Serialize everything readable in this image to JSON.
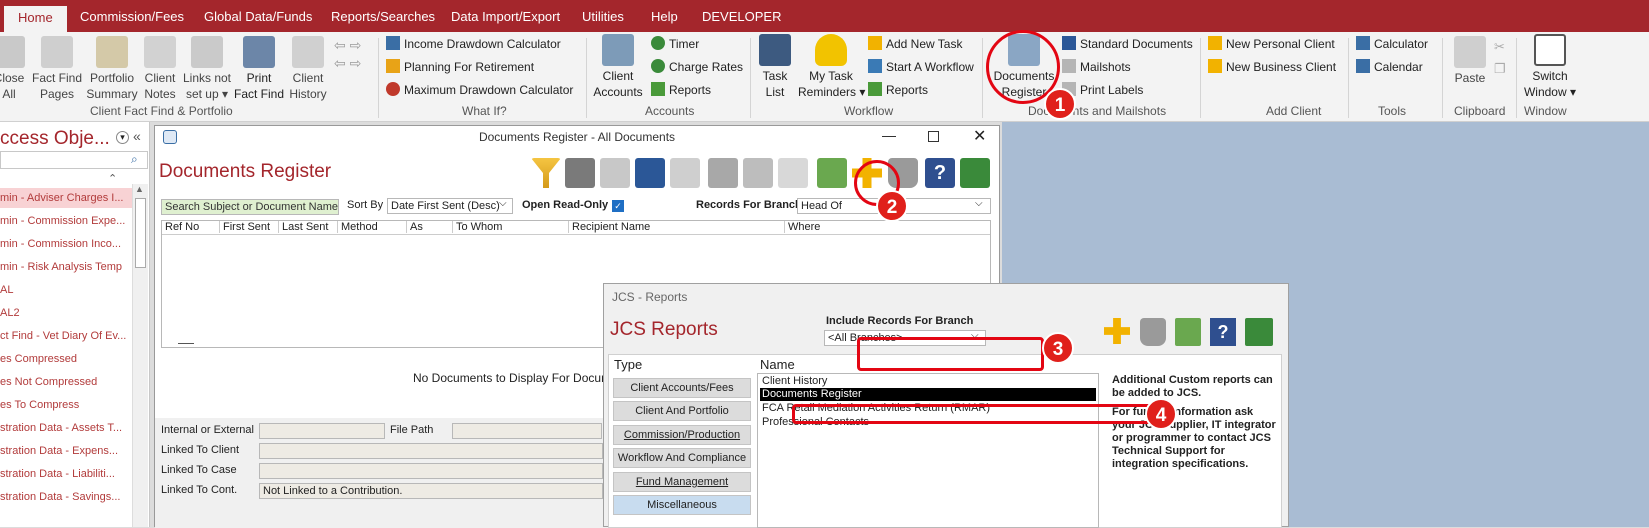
{
  "tabs": [
    "Home",
    "Commission/Fees",
    "Global Data/Funds",
    "Reports/Searches",
    "Data Import/Export",
    "Utilities",
    "Help",
    "DEVELOPER"
  ],
  "ribbon": {
    "big_buttons": [
      {
        "name": "close-all",
        "l1": "Close",
        "l2": "All"
      },
      {
        "name": "fact-find-pages",
        "l1": "Fact Find",
        "l2": "Pages"
      },
      {
        "name": "portfolio-summary",
        "l1": "Portfolio",
        "l2": "Summary"
      },
      {
        "name": "client-notes",
        "l1": "Client",
        "l2": "Notes"
      },
      {
        "name": "links-not-set-up",
        "l1": "Links not",
        "l2": "set up ▾"
      },
      {
        "name": "print-fact-find",
        "l1": "Print",
        "l2": "Fact Find"
      },
      {
        "name": "client-history",
        "l1": "Client",
        "l2": "History"
      },
      {
        "name": "client-accounts",
        "l1": "Client",
        "l2": "Accounts"
      },
      {
        "name": "task-list",
        "l1": "Task",
        "l2": "List"
      },
      {
        "name": "my-task-reminders",
        "l1": "My Task",
        "l2": "Reminders ▾"
      },
      {
        "name": "documents-register",
        "l1": "Documents",
        "l2": "Register"
      },
      {
        "name": "paste",
        "l1": "Paste",
        "l2": ""
      },
      {
        "name": "switch-window",
        "l1": "Switch",
        "l2": "Window ▾"
      }
    ],
    "small": {
      "income_drawdown": "Income Drawdown Calculator",
      "planning_retirement": "Planning For Retirement",
      "max_drawdown": "Maximum Drawdown Calculator",
      "timer": "Timer",
      "charge_rates": "Charge Rates",
      "reports": "Reports",
      "add_new_task": "Add New Task",
      "start_workflow": "Start A Workflow",
      "workflow_reports": "Reports",
      "standard_documents": "Standard Documents",
      "mailshots": "Mailshots",
      "print_labels": "Print Labels",
      "new_personal_client": "New Personal Client",
      "new_business_client": "New Business Client",
      "calculator": "Calculator",
      "calendar": "Calendar"
    },
    "groups": {
      "client_fact_find": "Client Fact Find & Portfolio",
      "what_if": "What If?",
      "accounts": "Accounts",
      "workflow": "Workflow",
      "documents_mailshots": "Documents and Mailshots",
      "add_client": "Add Client",
      "tools": "Tools",
      "clipboard": "Clipboard",
      "window": "Window"
    }
  },
  "nav": {
    "title": "ccess Obje...",
    "items": [
      "min - Adviser Charges I...",
      "min - Commission Expe...",
      "min - Commission Inco...",
      "min - Risk Analysis Temp",
      "AL",
      "AL2",
      "ct Find - Vet Diary Of Ev...",
      "es Compressed",
      "es Not Compressed",
      "es To Compress",
      "stration Data - Assets T...",
      "stration Data - Expens...",
      "stration Data - Liabiliti...",
      "stration Data - Savings..."
    ]
  },
  "docreg": {
    "window_title": "Documents Register - All Documents",
    "heading": "Documents Register",
    "search_placeholder": "Search Subject or Document Name",
    "sort_by_label": "Sort By",
    "sort_by_value": "Date First Sent (Desc)",
    "open_readonly_label": "Open Read-Only",
    "records_branch_label": "Records For Branch",
    "records_branch_value": "Head Of",
    "columns": [
      "Ref No",
      "First Sent",
      "Last Sent",
      "Method",
      "As",
      "To Whom",
      "Recipient Name",
      "Where"
    ],
    "empty_msg": "No Documents to Display For Documer",
    "internal_external": "Internal or External",
    "file_path": "File Path",
    "linked_client": "Linked To Client",
    "linked_case": "Linked To Case",
    "linked_cont": "Linked To Cont.",
    "linked_cont_value": "Not Linked to a Contribution."
  },
  "reports": {
    "window_title": "JCS - Reports",
    "heading": "JCS Reports",
    "include_branch_label": "Include Records For Branch",
    "branch_value": "<All Branches>",
    "type_label": "Type",
    "name_label": "Name",
    "types": [
      "Client Accounts/Fees",
      "Client And Portfolio",
      "Commission/Production",
      "Workflow And Compliance",
      "Fund Management",
      "Miscellaneous"
    ],
    "names": [
      "Client History",
      "Documents Register",
      "FCA Retail Mediation Activities Return (RMAR)",
      "Professional Contacts"
    ],
    "info1": "Additional Custom reports can be added to JCS.",
    "info2": "For further information ask your JCS supplier, IT integrator or programmer to contact JCS Technical Support for integration specifications."
  },
  "badges": [
    "1",
    "2",
    "3",
    "4"
  ],
  "colors": {
    "accent": "#a4262c",
    "callout": "#e30613",
    "desktop": "#a9bcd3"
  }
}
